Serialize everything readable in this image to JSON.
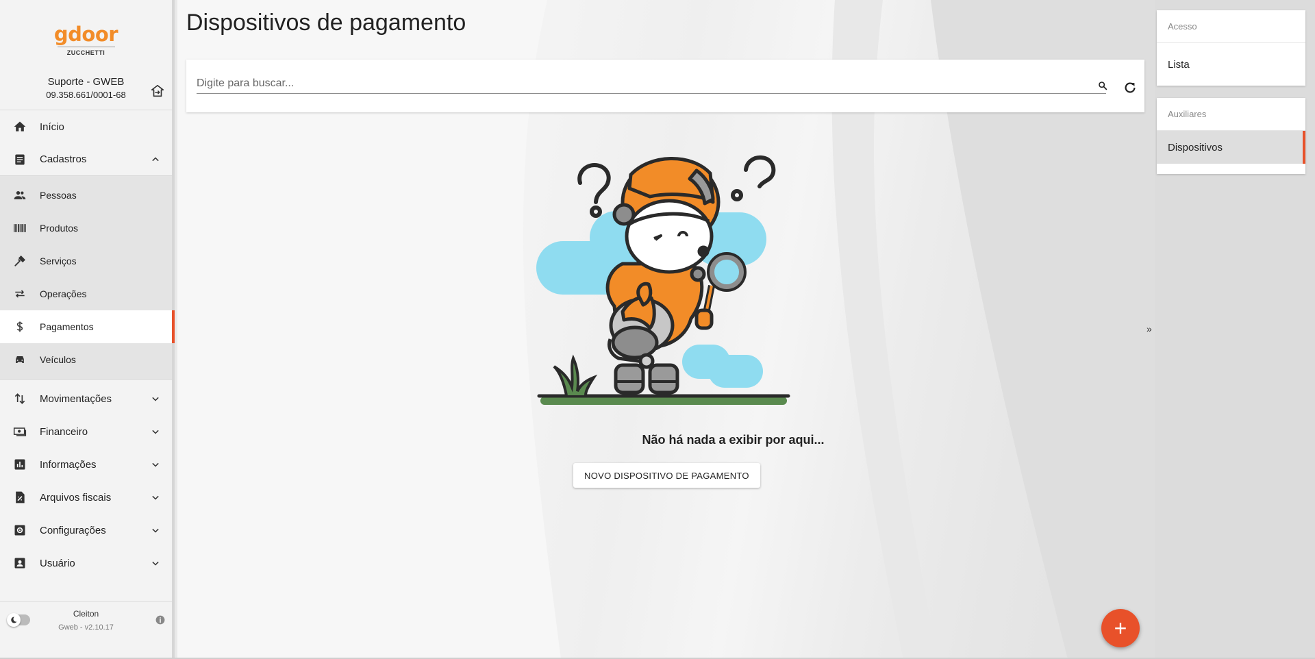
{
  "brand": {
    "logo": "gdoor",
    "logo_sub": "ZUCCHETTI"
  },
  "account": {
    "company": "Suporte - GWEB",
    "cnpj": "09.358.661/0001-68"
  },
  "nav": {
    "inicio": "Início",
    "cadastros": "Cadastros",
    "cadastros_items": [
      "Pessoas",
      "Produtos",
      "Serviços",
      "Operações",
      "Pagamentos",
      "Veículos"
    ],
    "movimentacoes": "Movimentações",
    "financeiro": "Financeiro",
    "informacoes": "Informações",
    "arquivos_fiscais": "Arquivos fiscais",
    "configuracoes": "Configurações",
    "usuario": "Usuário"
  },
  "footer": {
    "user": "Cleiton",
    "version": "Gweb - v2.10.17"
  },
  "page": {
    "title": "Dispositivos de pagamento",
    "search_placeholder": "Digite para buscar...",
    "empty_message": "Não há nada a exibir por aqui...",
    "new_button": "NOVO DISPOSITIVO DE PAGAMENTO",
    "fab": "+",
    "collapse_label": "»"
  },
  "right_panel": {
    "access_header": "Acesso",
    "access_item": "Lista",
    "aux_header": "Auxiliares",
    "aux_item": "Dispositivos"
  },
  "colors": {
    "accent": "#e8512a",
    "brand_orange": "#f28c28",
    "cloud": "#8fdcf0",
    "grass": "#5a8a4f"
  },
  "icons": [
    "home-icon",
    "list-icon",
    "people-icon",
    "barcode-icon",
    "wrench-icon",
    "swap-icon",
    "dollar-icon",
    "car-icon",
    "sort-icon",
    "cash-icon",
    "chart-icon",
    "fiscal-icon",
    "settings-icon",
    "user-icon",
    "search-icon",
    "refresh-icon",
    "switch-company-icon",
    "info-icon",
    "theme-icon"
  ]
}
